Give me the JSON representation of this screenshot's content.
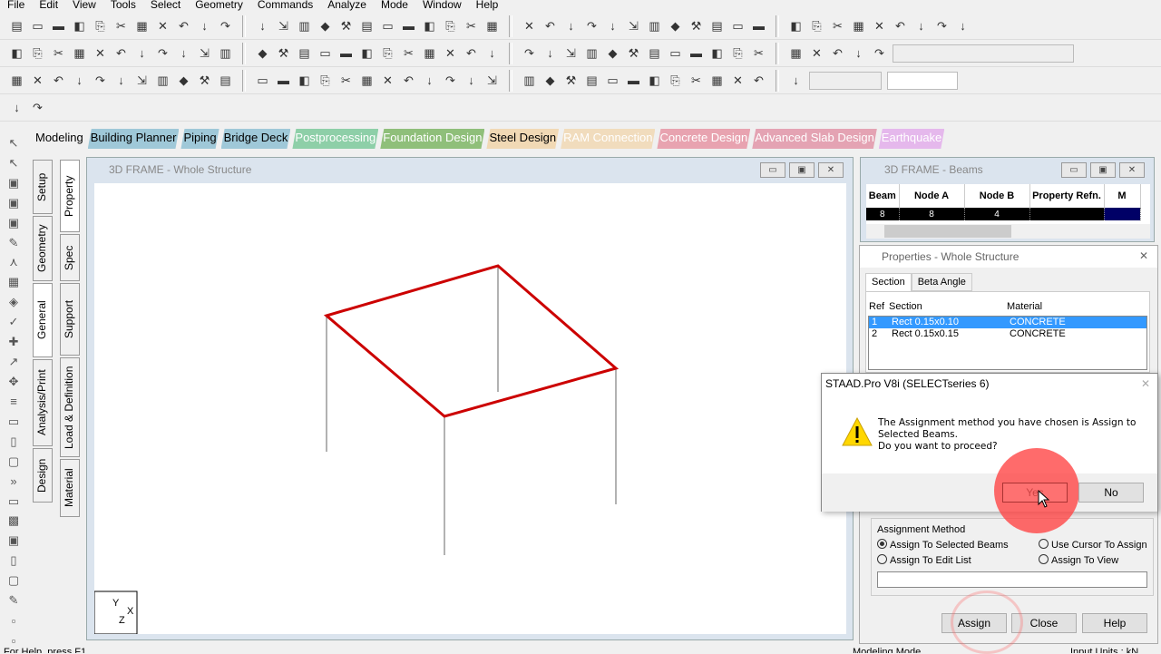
{
  "menu": [
    "File",
    "Edit",
    "View",
    "Tools",
    "Select",
    "Geometry",
    "Commands",
    "Analyze",
    "Mode",
    "Window",
    "Help"
  ],
  "mode_tabs": [
    {
      "label": "Modeling",
      "bg": "#f0f0f0",
      "fg": "#000"
    },
    {
      "label": "Building Planner",
      "bg": "#9fc8d8",
      "fg": "#000"
    },
    {
      "label": "Piping",
      "bg": "#9fc8d8",
      "fg": "#000"
    },
    {
      "label": "Bridge Deck",
      "bg": "#9fc8d8",
      "fg": "#000"
    },
    {
      "label": "Postprocessing",
      "bg": "#8ecfa8",
      "fg": "#fff"
    },
    {
      "label": "Foundation Design",
      "bg": "#8fbf7a",
      "fg": "#fff"
    },
    {
      "label": "Steel Design",
      "bg": "#f1d9b5",
      "fg": "#000"
    },
    {
      "label": "RAM Connection",
      "bg": "#f1dcbd",
      "fg": "#fff"
    },
    {
      "label": "Concrete Design",
      "bg": "#e8a3b0",
      "fg": "#fff"
    },
    {
      "label": "Advanced Slab Design",
      "bg": "#e4a3b3",
      "fg": "#fff"
    },
    {
      "label": "Earthquake",
      "bg": "#e5b8ec",
      "fg": "#fff"
    }
  ],
  "page_tabs_outer": [
    "Setup",
    "Geometry",
    "General",
    "Analysis/Print",
    "Design"
  ],
  "page_tabs_inner": [
    "Property",
    "Spec",
    "Support",
    "Load & Definition",
    "Material"
  ],
  "frame_window": {
    "title": "3D FRAME - Whole Structure",
    "axis_labels": {
      "y": "Y",
      "x": "X",
      "z": "Z"
    }
  },
  "beams_window": {
    "title": "3D FRAME - Beams",
    "columns": [
      "Beam",
      "Node A",
      "Node B",
      "Property Refn.",
      "M"
    ],
    "rows": [
      [
        "8",
        "8",
        "4",
        "",
        ""
      ]
    ]
  },
  "properties": {
    "title": "Properties - Whole Structure",
    "tabs": [
      "Section",
      "Beta Angle"
    ],
    "columns": [
      "Ref",
      "Section",
      "Material"
    ],
    "rows": [
      [
        "1",
        "Rect 0.15x0.10",
        "CONCRETE"
      ],
      [
        "2",
        "Rect 0.15x0.15",
        "CONCRETE"
      ]
    ],
    "assignment_method_label": "Assignment Method",
    "options": [
      {
        "label": "Assign To Selected Beams",
        "checked": true
      },
      {
        "label": "Use Cursor To Assign",
        "checked": false
      },
      {
        "label": "Assign To Edit List",
        "checked": false
      },
      {
        "label": "Assign To View",
        "checked": false
      }
    ],
    "buttons": {
      "assign": "Assign",
      "close": "Close",
      "help": "Help"
    }
  },
  "dialog": {
    "title": "STAAD.Pro V8i (SELECTseries 6)",
    "message_line1": "The Assignment method you have chosen is Assign to",
    "message_line2": "Selected Beams.",
    "message_line3": "Do you want to proceed?",
    "yes": "Yes",
    "no": "No",
    "icon": "warning-icon"
  },
  "status": {
    "left": "For Help, press F1",
    "mid": "Modeling Mode",
    "right": "Input Units : kN"
  },
  "colors": {
    "selection": "#3399ff",
    "beam": "#cc0000",
    "highlight_click": "#ff5050"
  }
}
